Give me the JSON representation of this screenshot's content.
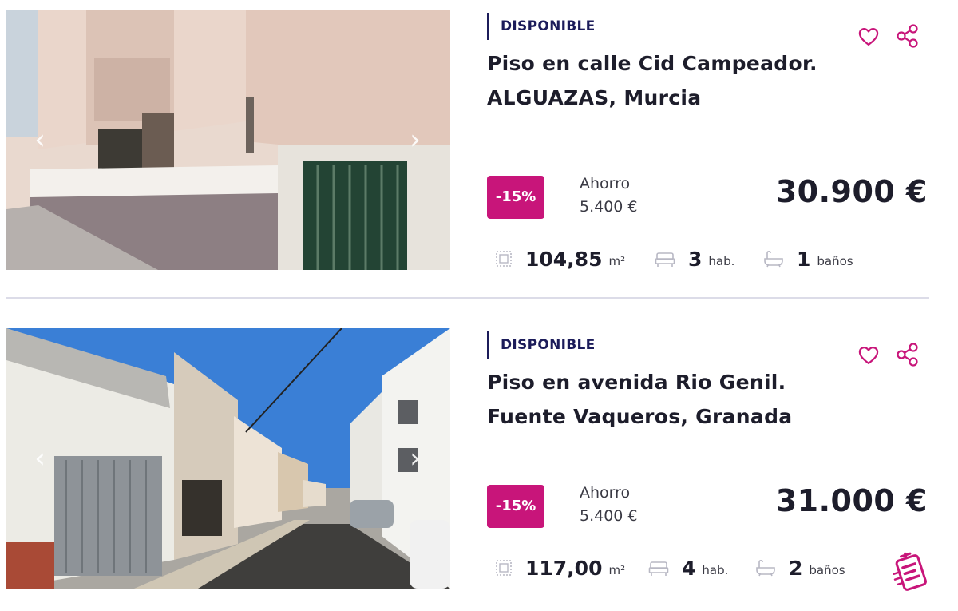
{
  "listings": [
    {
      "status": "DISPONIBLE",
      "title_line1": "Piso en calle Cid Campeador.",
      "title_line2": "ALGUAZAS, Murcia",
      "discount": "-15%",
      "savings_label": "Ahorro",
      "savings_value": "5.400 €",
      "price": "30.900 €",
      "area_value": "104,85",
      "area_unit": "m²",
      "rooms_value": "3",
      "rooms_unit": "hab.",
      "baths_value": "1",
      "baths_unit": "baños",
      "prev_arrow": "‹",
      "next_arrow": "›"
    },
    {
      "status": "DISPONIBLE",
      "title_line1": "Piso en avenida Rio Genil.",
      "title_line2": "Fuente Vaqueros, Granada",
      "discount": "-15%",
      "savings_label": "Ahorro",
      "savings_value": "5.400 €",
      "price": "31.000 €",
      "area_value": "117,00",
      "area_unit": "m²",
      "rooms_value": "4",
      "rooms_unit": "hab.",
      "baths_value": "2",
      "baths_unit": "baños",
      "prev_arrow": "‹",
      "next_arrow": "›"
    }
  ],
  "icons": {
    "favorite": "heart-icon",
    "share": "share-icon",
    "area": "area-icon",
    "rooms": "bed-icon",
    "baths": "bathtub-icon",
    "promo": "promo-badge-icon"
  },
  "colors": {
    "accent": "#c8157a",
    "status_bar": "#1c1c5a",
    "text": "#1d1d2b"
  }
}
